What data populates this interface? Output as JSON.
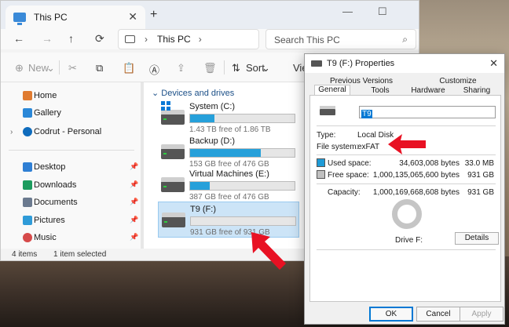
{
  "explorer": {
    "tab_title": "This PC",
    "tab_close": "✕",
    "new_tab": "+",
    "window_controls": {
      "minimize": "—",
      "maximize": "☐",
      "close": "✕"
    },
    "nav": {
      "back": "←",
      "forward": "→",
      "up": "↑",
      "refresh": "⟳"
    },
    "address": {
      "segment": "This PC",
      "chevron": "›",
      "trail_chevron": "›"
    },
    "search": {
      "placeholder": "Search This PC",
      "icon": "⌕"
    },
    "toolbar": {
      "new_label": "New",
      "new_icon": "⊕",
      "cut_icon": "✂",
      "copy_icon": "⧉",
      "paste_icon": "📋",
      "rename_icon": "Ⓐ",
      "share_icon": "⇪",
      "delete_icon": "🗑",
      "sort_label": "Sort",
      "sort_icon": "⇅",
      "view_label": "Vie",
      "dropdown": "⌄"
    },
    "sidebar": {
      "items": [
        {
          "label": "Home",
          "icon": "home-icon",
          "color": "#e07b30"
        },
        {
          "label": "Gallery",
          "icon": "gallery-icon",
          "color": "#2b88d8"
        },
        {
          "label": "Codrut - Personal",
          "icon": "cloud-icon",
          "color": "#0f6cbd",
          "chevron": "›"
        },
        {
          "label": "Desktop",
          "icon": "desktop-icon",
          "color": "#2f7fd4",
          "pin": "📌"
        },
        {
          "label": "Downloads",
          "icon": "downloads-icon",
          "color": "#1c9b5e",
          "pin": "📌"
        },
        {
          "label": "Documents",
          "icon": "documents-icon",
          "color": "#6b7a8f",
          "pin": "📌"
        },
        {
          "label": "Pictures",
          "icon": "pictures-icon",
          "color": "#2f9bd8",
          "pin": "📌"
        },
        {
          "label": "Music",
          "icon": "music-icon",
          "color": "#d64a4a",
          "pin": "📌"
        }
      ]
    },
    "group_header": "Devices and drives",
    "group_chevron": "⌄",
    "drives": [
      {
        "name": "System (C:)",
        "free": "1.43 TB free of 1.86 TB",
        "used_fraction": 0.23
      },
      {
        "name": "Backup (D:)",
        "free": "153 GB free of 476 GB",
        "used_fraction": 0.68
      },
      {
        "name": "Virtual Machines (E:)",
        "free": "387 GB free of 476 GB",
        "used_fraction": 0.19
      },
      {
        "name": "T9 (F:)",
        "free": "931 GB free of 931 GB",
        "used_fraction": 0.0
      }
    ],
    "status": {
      "items": "4 items",
      "selected": "1 item selected"
    }
  },
  "properties": {
    "title": "T9 (F:) Properties",
    "close": "✕",
    "tabs_row1": [
      "Previous Versions",
      "Customize"
    ],
    "tabs_row2": [
      "General",
      "Tools",
      "Hardware",
      "Sharing"
    ],
    "name_value": "T9",
    "type_label": "Type:",
    "type_value": "Local Disk",
    "fs_label": "File system:",
    "fs_value": "exFAT",
    "used_label": "Used space:",
    "used_bytes": "34,603,008 bytes",
    "used_size": "33.0 MB",
    "free_label": "Free space:",
    "free_bytes": "1,000,135,065,600 bytes",
    "free_size": "931 GB",
    "capacity_label": "Capacity:",
    "capacity_bytes": "1,000,169,668,608 bytes",
    "capacity_size": "931 GB",
    "drive_label": "Drive F:",
    "details_label": "Details",
    "ok_label": "OK",
    "cancel_label": "Cancel",
    "apply_label": "Apply",
    "used_color": "#1e9bd7",
    "free_color": "#c0c0c0"
  },
  "annotation_color": "#e81123"
}
